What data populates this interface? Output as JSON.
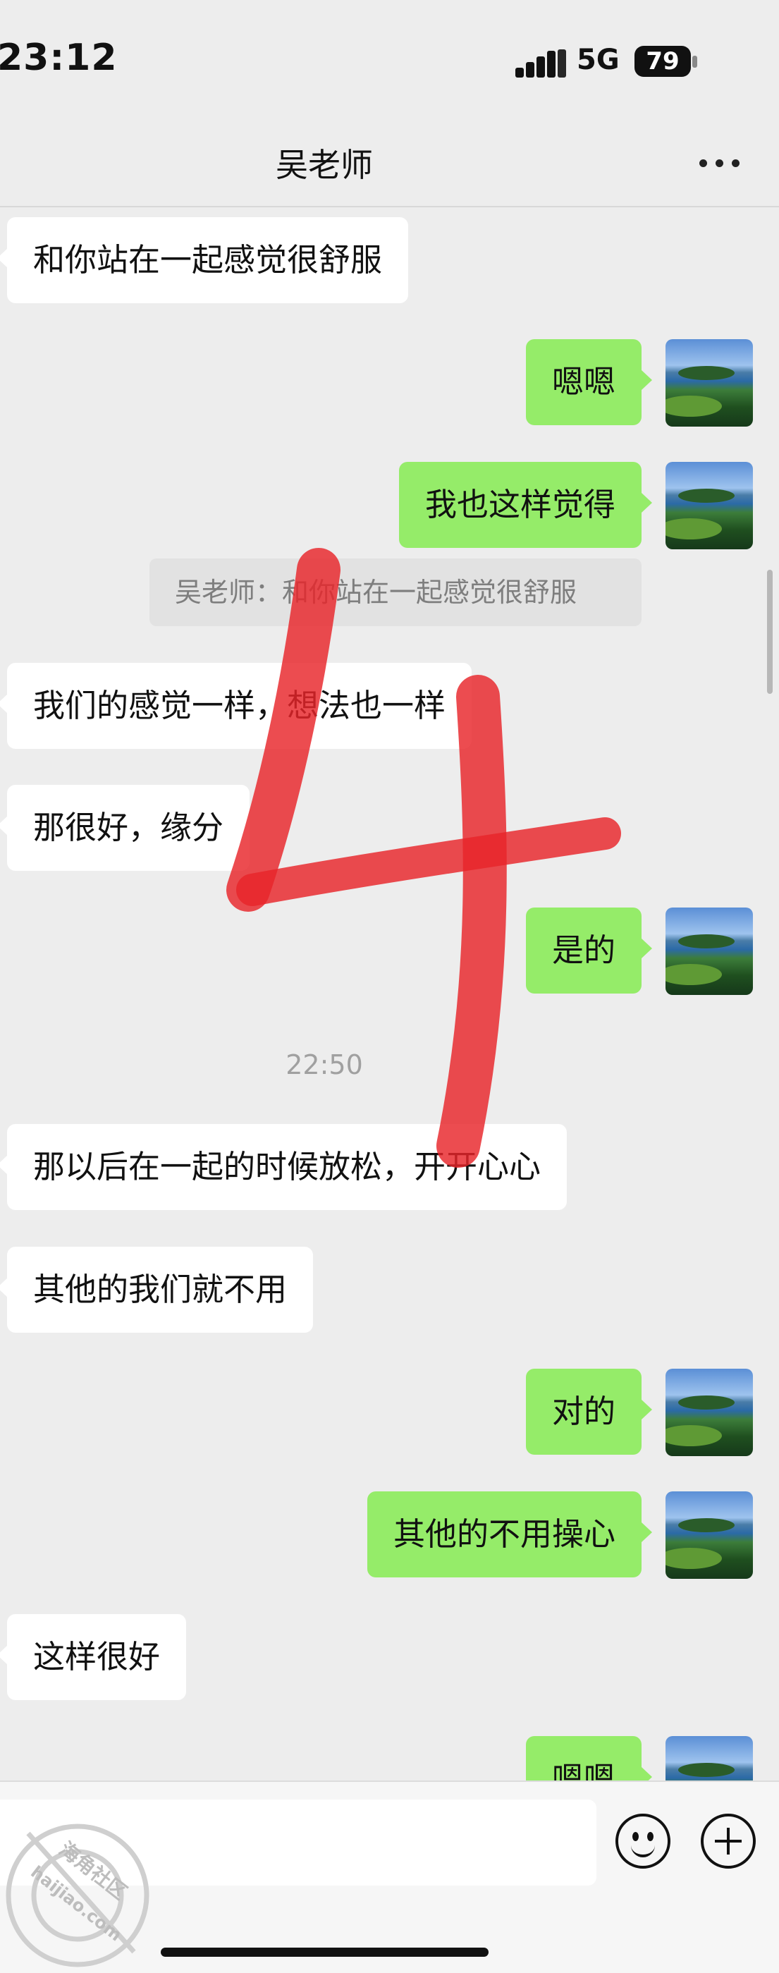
{
  "status_bar": {
    "time": "23:12",
    "network": "5G",
    "battery": "79"
  },
  "header": {
    "title": "吴老师"
  },
  "messages": [
    {
      "side": "left",
      "text": "和你站在一起感觉很舒服"
    },
    {
      "side": "right",
      "text": "嗯嗯"
    },
    {
      "side": "right",
      "text": "我也这样觉得"
    },
    {
      "type": "quote",
      "text": "吴老师：和你站在一起感觉很舒服"
    },
    {
      "side": "left",
      "text": "我们的感觉一样，想法也一样"
    },
    {
      "side": "left",
      "text": "那很好，缘分"
    },
    {
      "side": "right",
      "text": "是的"
    },
    {
      "type": "time",
      "text": "22:50"
    },
    {
      "side": "left",
      "text": "那以后在一起的时候放松，开开心心"
    },
    {
      "side": "left",
      "text": "其他的我们就不用"
    },
    {
      "side": "right",
      "text": "对的"
    },
    {
      "side": "right",
      "text": "其他的不用操心"
    },
    {
      "side": "left",
      "text": "这样很好"
    },
    {
      "side": "right",
      "text": "嗯嗯"
    }
  ],
  "overlay": {
    "annotation": "4",
    "annotation_color": "#e8252a"
  },
  "watermark": {
    "text": "海角社区",
    "url": "haijiao.com"
  },
  "colors": {
    "self_bubble": "#95ec69",
    "other_bubble": "#ffffff",
    "background": "#ededed"
  }
}
